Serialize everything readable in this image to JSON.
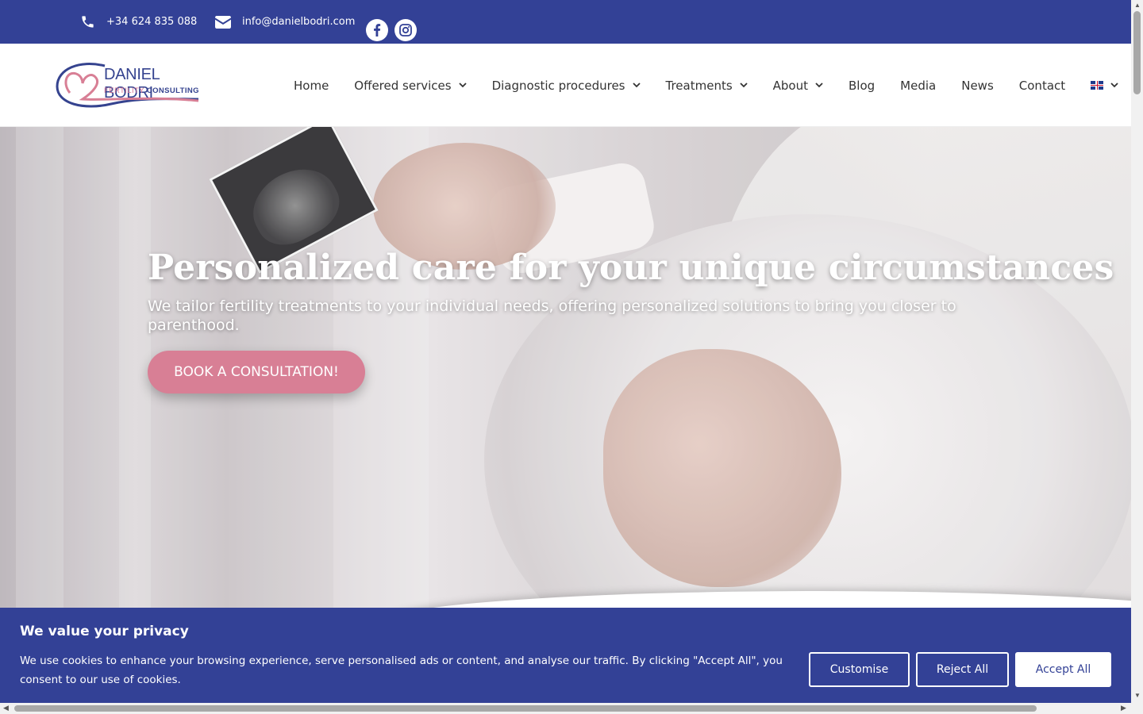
{
  "topbar": {
    "phone": "+34 624 835 088",
    "email": "info@danielbodri.com",
    "social": [
      "facebook-icon",
      "instagram-icon"
    ]
  },
  "logo": {
    "name": "DANIEL BODRI",
    "tag_part1": "FERTILITY",
    "tag_part2": "CONSULTING"
  },
  "nav": {
    "items": [
      {
        "label": "Home",
        "dropdown": false
      },
      {
        "label": "Offered services",
        "dropdown": true
      },
      {
        "label": "Diagnostic procedures",
        "dropdown": true
      },
      {
        "label": "Treatments",
        "dropdown": true
      },
      {
        "label": "About",
        "dropdown": true
      },
      {
        "label": "Blog",
        "dropdown": false
      },
      {
        "label": "Media",
        "dropdown": false
      },
      {
        "label": "News",
        "dropdown": false
      },
      {
        "label": "Contact",
        "dropdown": false
      }
    ],
    "language_icon": "uk-flag-icon"
  },
  "hero": {
    "title": "Personalized care for your unique circumstances",
    "subtitle": "We tailor fertility treatments to your individual needs, offering personalized solutions to bring you closer to parenthood.",
    "cta": "BOOK A CONSULTATION!"
  },
  "cookie": {
    "title": "We value your privacy",
    "text": "We use cookies to enhance your browsing experience, serve personalised ads or content, and analyse our traffic. By clicking \"Accept All\", you consent to our use of cookies.",
    "customise": "Customise",
    "reject": "Reject All",
    "accept": "Accept All"
  },
  "colors": {
    "brand_blue": "#334196",
    "brand_pink": "#d87f95"
  }
}
